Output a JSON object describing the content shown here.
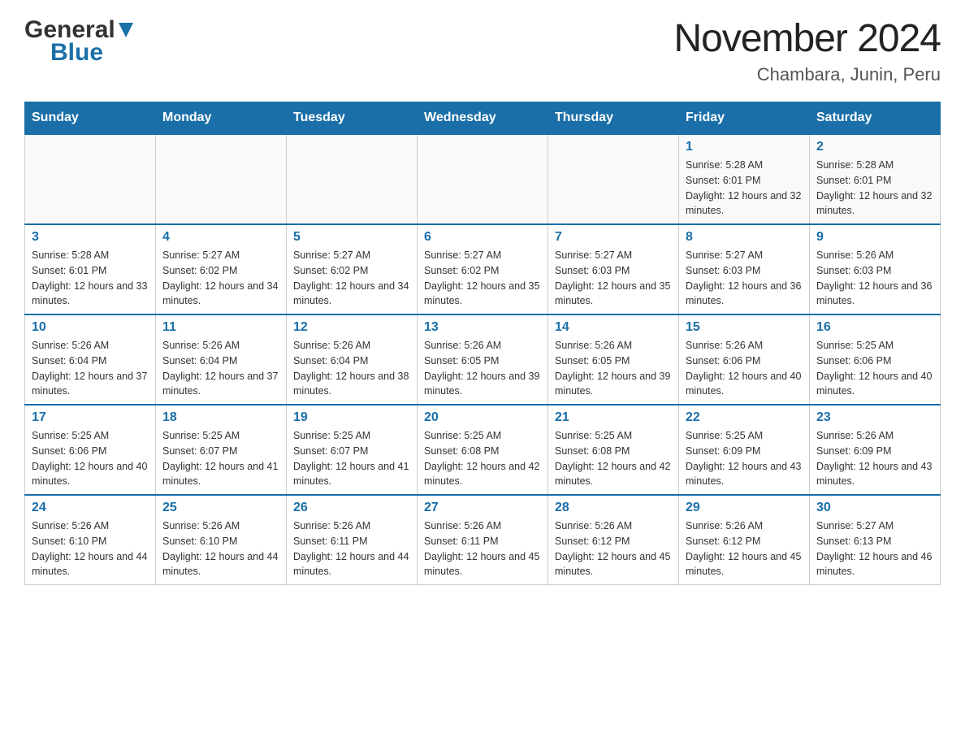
{
  "header": {
    "logo_general": "General",
    "logo_blue": "Blue",
    "month_year": "November 2024",
    "location": "Chambara, Junin, Peru"
  },
  "days_of_week": [
    "Sunday",
    "Monday",
    "Tuesday",
    "Wednesday",
    "Thursday",
    "Friday",
    "Saturday"
  ],
  "weeks": [
    [
      {
        "day": "",
        "sunrise": "",
        "sunset": "",
        "daylight": ""
      },
      {
        "day": "",
        "sunrise": "",
        "sunset": "",
        "daylight": ""
      },
      {
        "day": "",
        "sunrise": "",
        "sunset": "",
        "daylight": ""
      },
      {
        "day": "",
        "sunrise": "",
        "sunset": "",
        "daylight": ""
      },
      {
        "day": "",
        "sunrise": "",
        "sunset": "",
        "daylight": ""
      },
      {
        "day": "1",
        "sunrise": "Sunrise: 5:28 AM",
        "sunset": "Sunset: 6:01 PM",
        "daylight": "Daylight: 12 hours and 32 minutes."
      },
      {
        "day": "2",
        "sunrise": "Sunrise: 5:28 AM",
        "sunset": "Sunset: 6:01 PM",
        "daylight": "Daylight: 12 hours and 32 minutes."
      }
    ],
    [
      {
        "day": "3",
        "sunrise": "Sunrise: 5:28 AM",
        "sunset": "Sunset: 6:01 PM",
        "daylight": "Daylight: 12 hours and 33 minutes."
      },
      {
        "day": "4",
        "sunrise": "Sunrise: 5:27 AM",
        "sunset": "Sunset: 6:02 PM",
        "daylight": "Daylight: 12 hours and 34 minutes."
      },
      {
        "day": "5",
        "sunrise": "Sunrise: 5:27 AM",
        "sunset": "Sunset: 6:02 PM",
        "daylight": "Daylight: 12 hours and 34 minutes."
      },
      {
        "day": "6",
        "sunrise": "Sunrise: 5:27 AM",
        "sunset": "Sunset: 6:02 PM",
        "daylight": "Daylight: 12 hours and 35 minutes."
      },
      {
        "day": "7",
        "sunrise": "Sunrise: 5:27 AM",
        "sunset": "Sunset: 6:03 PM",
        "daylight": "Daylight: 12 hours and 35 minutes."
      },
      {
        "day": "8",
        "sunrise": "Sunrise: 5:27 AM",
        "sunset": "Sunset: 6:03 PM",
        "daylight": "Daylight: 12 hours and 36 minutes."
      },
      {
        "day": "9",
        "sunrise": "Sunrise: 5:26 AM",
        "sunset": "Sunset: 6:03 PM",
        "daylight": "Daylight: 12 hours and 36 minutes."
      }
    ],
    [
      {
        "day": "10",
        "sunrise": "Sunrise: 5:26 AM",
        "sunset": "Sunset: 6:04 PM",
        "daylight": "Daylight: 12 hours and 37 minutes."
      },
      {
        "day": "11",
        "sunrise": "Sunrise: 5:26 AM",
        "sunset": "Sunset: 6:04 PM",
        "daylight": "Daylight: 12 hours and 37 minutes."
      },
      {
        "day": "12",
        "sunrise": "Sunrise: 5:26 AM",
        "sunset": "Sunset: 6:04 PM",
        "daylight": "Daylight: 12 hours and 38 minutes."
      },
      {
        "day": "13",
        "sunrise": "Sunrise: 5:26 AM",
        "sunset": "Sunset: 6:05 PM",
        "daylight": "Daylight: 12 hours and 39 minutes."
      },
      {
        "day": "14",
        "sunrise": "Sunrise: 5:26 AM",
        "sunset": "Sunset: 6:05 PM",
        "daylight": "Daylight: 12 hours and 39 minutes."
      },
      {
        "day": "15",
        "sunrise": "Sunrise: 5:26 AM",
        "sunset": "Sunset: 6:06 PM",
        "daylight": "Daylight: 12 hours and 40 minutes."
      },
      {
        "day": "16",
        "sunrise": "Sunrise: 5:25 AM",
        "sunset": "Sunset: 6:06 PM",
        "daylight": "Daylight: 12 hours and 40 minutes."
      }
    ],
    [
      {
        "day": "17",
        "sunrise": "Sunrise: 5:25 AM",
        "sunset": "Sunset: 6:06 PM",
        "daylight": "Daylight: 12 hours and 40 minutes."
      },
      {
        "day": "18",
        "sunrise": "Sunrise: 5:25 AM",
        "sunset": "Sunset: 6:07 PM",
        "daylight": "Daylight: 12 hours and 41 minutes."
      },
      {
        "day": "19",
        "sunrise": "Sunrise: 5:25 AM",
        "sunset": "Sunset: 6:07 PM",
        "daylight": "Daylight: 12 hours and 41 minutes."
      },
      {
        "day": "20",
        "sunrise": "Sunrise: 5:25 AM",
        "sunset": "Sunset: 6:08 PM",
        "daylight": "Daylight: 12 hours and 42 minutes."
      },
      {
        "day": "21",
        "sunrise": "Sunrise: 5:25 AM",
        "sunset": "Sunset: 6:08 PM",
        "daylight": "Daylight: 12 hours and 42 minutes."
      },
      {
        "day": "22",
        "sunrise": "Sunrise: 5:25 AM",
        "sunset": "Sunset: 6:09 PM",
        "daylight": "Daylight: 12 hours and 43 minutes."
      },
      {
        "day": "23",
        "sunrise": "Sunrise: 5:26 AM",
        "sunset": "Sunset: 6:09 PM",
        "daylight": "Daylight: 12 hours and 43 minutes."
      }
    ],
    [
      {
        "day": "24",
        "sunrise": "Sunrise: 5:26 AM",
        "sunset": "Sunset: 6:10 PM",
        "daylight": "Daylight: 12 hours and 44 minutes."
      },
      {
        "day": "25",
        "sunrise": "Sunrise: 5:26 AM",
        "sunset": "Sunset: 6:10 PM",
        "daylight": "Daylight: 12 hours and 44 minutes."
      },
      {
        "day": "26",
        "sunrise": "Sunrise: 5:26 AM",
        "sunset": "Sunset: 6:11 PM",
        "daylight": "Daylight: 12 hours and 44 minutes."
      },
      {
        "day": "27",
        "sunrise": "Sunrise: 5:26 AM",
        "sunset": "Sunset: 6:11 PM",
        "daylight": "Daylight: 12 hours and 45 minutes."
      },
      {
        "day": "28",
        "sunrise": "Sunrise: 5:26 AM",
        "sunset": "Sunset: 6:12 PM",
        "daylight": "Daylight: 12 hours and 45 minutes."
      },
      {
        "day": "29",
        "sunrise": "Sunrise: 5:26 AM",
        "sunset": "Sunset: 6:12 PM",
        "daylight": "Daylight: 12 hours and 45 minutes."
      },
      {
        "day": "30",
        "sunrise": "Sunrise: 5:27 AM",
        "sunset": "Sunset: 6:13 PM",
        "daylight": "Daylight: 12 hours and 46 minutes."
      }
    ]
  ]
}
